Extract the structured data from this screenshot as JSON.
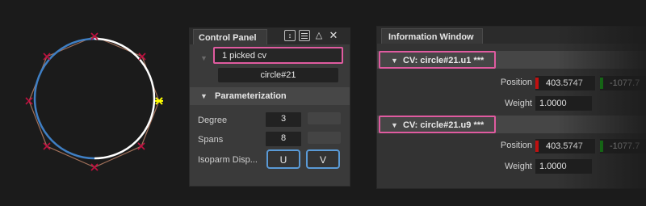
{
  "control_panel": {
    "title": "Control Panel",
    "icons": [
      "split-icon",
      "list-icon",
      "up-triangle-icon",
      "close-icon"
    ],
    "picked_label": "1 picked cv",
    "object_name": "circle#21",
    "parameterization_header": "Parameterization",
    "degree_label": "Degree",
    "degree_value": "3",
    "spans_label": "Spans",
    "spans_value": "8",
    "isoparm_label": "Isoparm Disp...",
    "u_label": "U",
    "v_label": "V"
  },
  "info_window": {
    "title": "Information Window",
    "cvs": [
      {
        "name": "CV: circle#21.u1 ***",
        "position_label": "Position",
        "x": "403.5747",
        "y": "-1077.7",
        "weight_label": "Weight",
        "weight": "1.0000"
      },
      {
        "name": "CV: circle#21.u9 ***",
        "position_label": "Position",
        "x": "403.5747",
        "y": "-1077.7",
        "weight_label": "Weight",
        "weight": "1.0000"
      }
    ]
  },
  "colors": {
    "highlight": "#e05ba0",
    "button_outline": "#5a9ad6",
    "curve_blue": "#3f7fc4",
    "curve_white": "#ffffff",
    "hull": "#a0705a",
    "cv_marker": "#c01040",
    "selected_cv": "#ffff00",
    "x_axis": "#c01010",
    "y_axis": "#10a010"
  }
}
